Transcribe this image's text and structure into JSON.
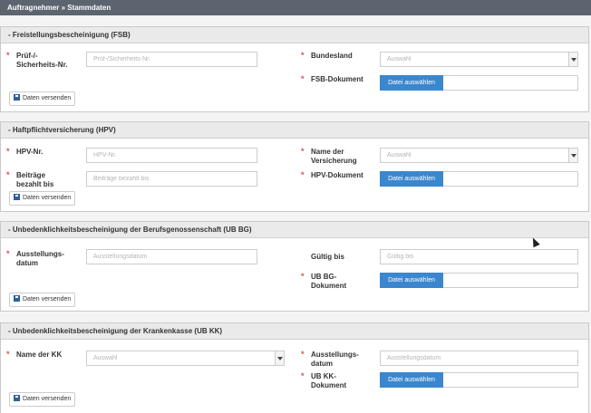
{
  "breadcrumb": "Auftragnehmer » Stammdaten",
  "send_label": "Daten versenden",
  "file_button": "Datei auswählen",
  "select_placeholder": "Auswahl",
  "panels": [
    {
      "title": "- Freistellungsbescheinigung (FSB)",
      "fields": {
        "pruef_label": "Prüf-/- Sicherheits-Nr.",
        "pruef_placeholder": "Prüf-/Sicherheits-Nr.",
        "bundesland_label": "Bundesland",
        "fsb_doc_label": "FSB-Dokument"
      }
    },
    {
      "title": "- Haftpflichtversicherung (HPV)",
      "fields": {
        "hpv_nr_label": "HPV-Nr.",
        "hpv_nr_placeholder": "HPV-Nr.",
        "beitraege_label": "Beiträge bezahlt bis",
        "beitraege_placeholder": "Beiträge bezahlt bis",
        "versicherung_label": "Name der Versicherung",
        "hpv_doc_label": "HPV-Dokument"
      }
    },
    {
      "title": "- Unbedenklichkeitsbescheinigung der Berufsgenossenschaft (UB BG)",
      "fields": {
        "ausstellung_label": "Ausstellungs- datum",
        "ausstellung_placeholder": "Ausstellungsdatum",
        "gueltig_label": "Gültig bis",
        "gueltig_placeholder": "Gültig bis",
        "ubbg_doc_label": "UB BG-Dokument"
      }
    },
    {
      "title": "- Unbedenklichkeitsbescheinigung der Krankenkasse (UB KK)",
      "fields": {
        "kk_label": "Name der KK",
        "ausstellung_label": "Ausstellungs- datum",
        "ausstellung_placeholder": "Ausstellungsdatum",
        "ubkk_doc_label": "UB KK-Dokument"
      }
    }
  ],
  "colors": {
    "topbar": "#5c6470",
    "required": "#d9534f",
    "file_button": "#3a87cf",
    "panel_head": "#eaeaea"
  }
}
